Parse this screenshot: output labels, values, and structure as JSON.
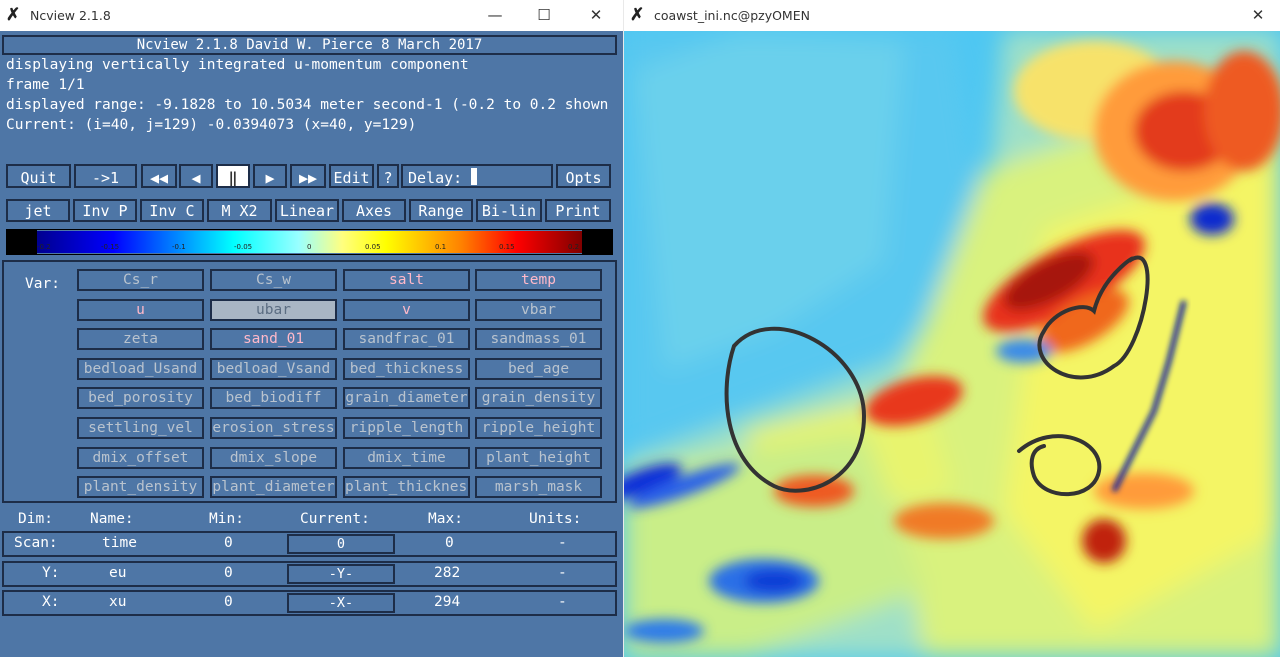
{
  "left_window": {
    "title": "Ncview 2.1.8",
    "controls": {
      "minimize": "—",
      "maximize": "☐",
      "close": "✕"
    },
    "header": "Ncview 2.1.8 David W. Pierce  8 March 2017",
    "info_lines": [
      "displaying vertically integrated u-momentum component",
      "frame 1/1",
      "displayed range: -9.1828 to 10.5034 meter second-1 (-0.2 to 0.2 shown",
      "Current: (i=40, j=129) -0.0394073 (x=40, y=129)"
    ],
    "toolbar1": {
      "quit": "Quit",
      "goto": "->1",
      "rewind": "◀◀",
      "back": "◀",
      "pause": "‖",
      "forward": "▶",
      "fastforward": "▶▶",
      "edit": "Edit",
      "help": "?",
      "delay_label": "Delay:",
      "opts": "Opts"
    },
    "toolbar2": [
      "jet",
      "Inv P",
      "Inv C",
      "M X2",
      "Linear",
      "Axes",
      "Range",
      "Bi-lin",
      "Print"
    ],
    "colorbar_labels": [
      "-0.2",
      "-0.15",
      "-0.1",
      "-0.05",
      "0",
      "0.05",
      "0.1",
      "0.15",
      "0.2"
    ],
    "var_label": "Var:",
    "variables": [
      [
        "Cs_r",
        "Cs_w",
        "salt",
        "temp"
      ],
      [
        "u",
        "ubar",
        "v",
        "vbar"
      ],
      [
        "zeta",
        "sand_01",
        "sandfrac_01",
        "sandmass_01"
      ],
      [
        "bedload_Usand",
        "bedload_Vsand",
        "bed_thickness",
        "bed_age"
      ],
      [
        "bed_porosity",
        "bed_biodiff",
        "grain_diameter",
        "grain_density"
      ],
      [
        "settling_vel",
        "erosion_stress",
        "ripple_length",
        "ripple_height"
      ],
      [
        "dmix_offset",
        "dmix_slope",
        "dmix_time",
        "plant_height"
      ],
      [
        "plant_density",
        "plant_diameter",
        "plant_thickness",
        "marsh_mask"
      ]
    ],
    "selected_var": "ubar",
    "dim_headers": {
      "dim": "Dim:",
      "name": "Name:",
      "min": "Min:",
      "current": "Current:",
      "max": "Max:",
      "units": "Units:"
    },
    "dims": [
      {
        "dim": "Scan:",
        "name": "time",
        "min": "0",
        "current": "0",
        "max": "0",
        "units": "-"
      },
      {
        "dim": "Y:",
        "name": "eu",
        "min": "0",
        "current": "-Y-",
        "max": "282",
        "units": "-"
      },
      {
        "dim": "X:",
        "name": "xu",
        "min": "0",
        "current": "-X-",
        "max": "294",
        "units": "-"
      }
    ]
  },
  "right_window": {
    "title": "coawst_ini.nc@pzyOMEN",
    "close": "✕"
  }
}
